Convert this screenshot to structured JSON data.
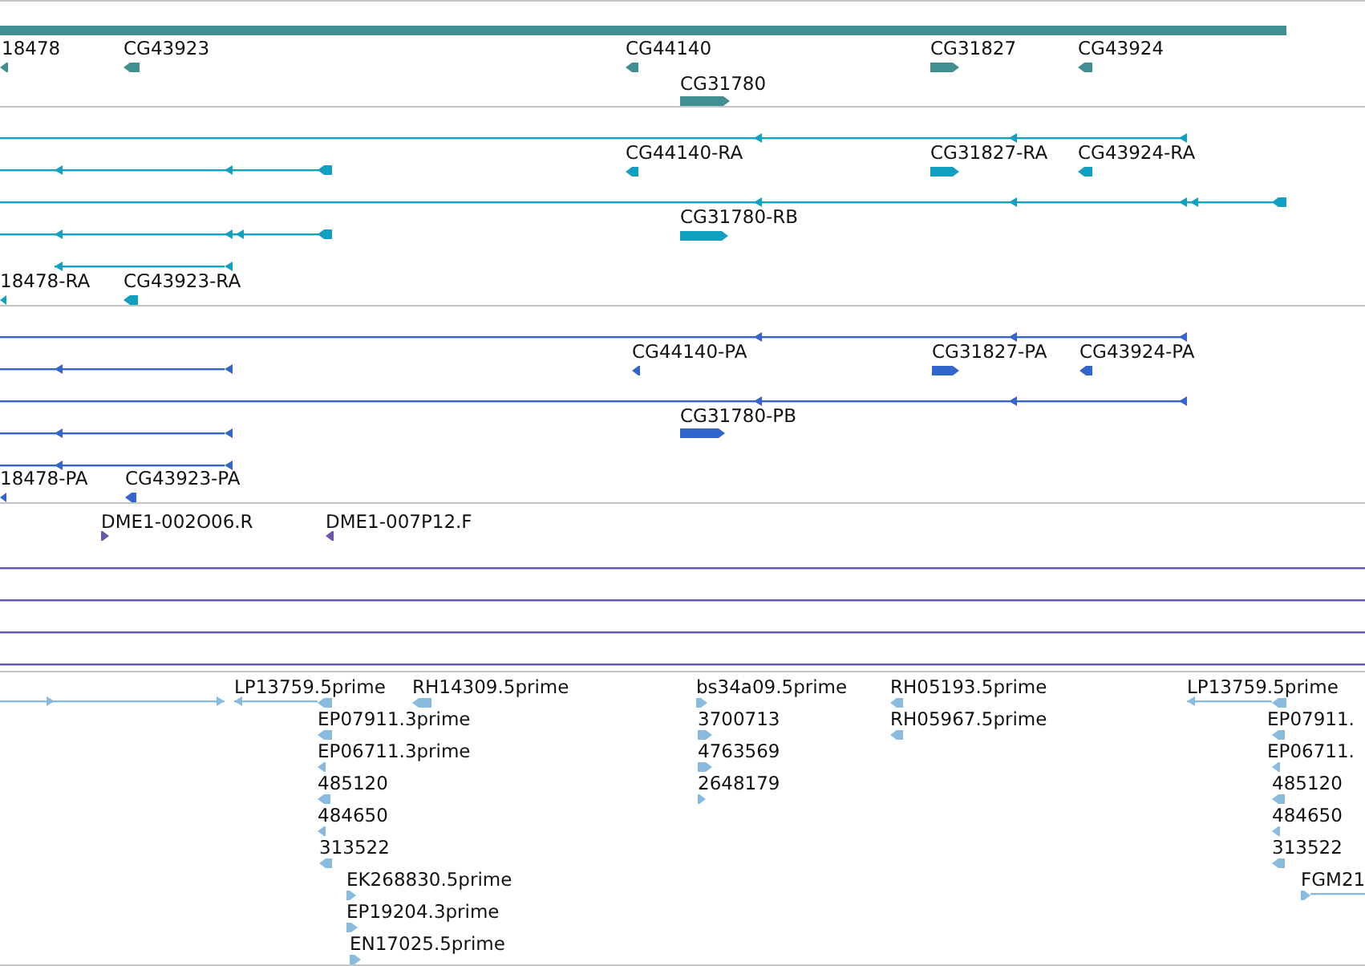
{
  "tracks": [
    {
      "kind": "gene",
      "features": [
        {
          "label": "18478",
          "reverse": true
        },
        {
          "label": "CG43923",
          "reverse": true
        },
        {
          "label": "CG44140",
          "reverse": true
        },
        {
          "label": "CG31780",
          "reverse": false
        },
        {
          "label": "CG31827",
          "reverse": false
        },
        {
          "label": "CG43924",
          "reverse": true
        }
      ]
    },
    {
      "kind": "transcript",
      "features": [
        {
          "label": "CG44140-RA",
          "reverse": true
        },
        {
          "label": "CG31827-RA",
          "reverse": false
        },
        {
          "label": "CG43924-RA",
          "reverse": true
        },
        {
          "label": "CG31780-RB",
          "reverse": false
        },
        {
          "label": "18478-RA",
          "reverse": true
        },
        {
          "label": "CG43923-RA",
          "reverse": true
        }
      ]
    },
    {
      "kind": "protein",
      "features": [
        {
          "label": "CG44140-PA",
          "reverse": true
        },
        {
          "label": "CG31827-PA",
          "reverse": false
        },
        {
          "label": "CG43924-PA",
          "reverse": true
        },
        {
          "label": "CG31780-PB",
          "reverse": false
        },
        {
          "label": "18478-PA",
          "reverse": true
        },
        {
          "label": "CG43923-PA",
          "reverse": true
        }
      ]
    },
    {
      "kind": "marker",
      "features": [
        {
          "label": "DME1-002O06.R",
          "reverse": false
        },
        {
          "label": "DME1-007P12.F",
          "reverse": true
        }
      ]
    },
    {
      "kind": "est",
      "features": [
        {
          "label": "LP13759.5prime",
          "reverse": true
        },
        {
          "label": "RH14309.5prime",
          "reverse": true
        },
        {
          "label": "EP07911.3prime",
          "reverse": true
        },
        {
          "label": "EP06711.3prime",
          "reverse": true
        },
        {
          "label": "485120",
          "reverse": true
        },
        {
          "label": "484650",
          "reverse": true
        },
        {
          "label": "313522",
          "reverse": true
        },
        {
          "label": "EK268830.5prime",
          "reverse": false
        },
        {
          "label": "EP19204.3prime",
          "reverse": false
        },
        {
          "label": "EN17025.5prime",
          "reverse": false
        },
        {
          "label": "bs34a09.5prime",
          "reverse": false
        },
        {
          "label": "3700713",
          "reverse": false
        },
        {
          "label": "4763569",
          "reverse": false
        },
        {
          "label": "2648179",
          "reverse": false
        },
        {
          "label": "RH05193.5prime",
          "reverse": true
        },
        {
          "label": "RH05967.5prime",
          "reverse": true
        },
        {
          "label": "LP13759.5prime",
          "reverse": true
        },
        {
          "label": "EP07911.",
          "reverse": true
        },
        {
          "label": "EP06711.",
          "reverse": true
        },
        {
          "label": "485120",
          "reverse": true
        },
        {
          "label": "484650",
          "reverse": true
        },
        {
          "label": "313522",
          "reverse": true
        },
        {
          "label": "FGM21",
          "reverse": false
        }
      ]
    }
  ]
}
